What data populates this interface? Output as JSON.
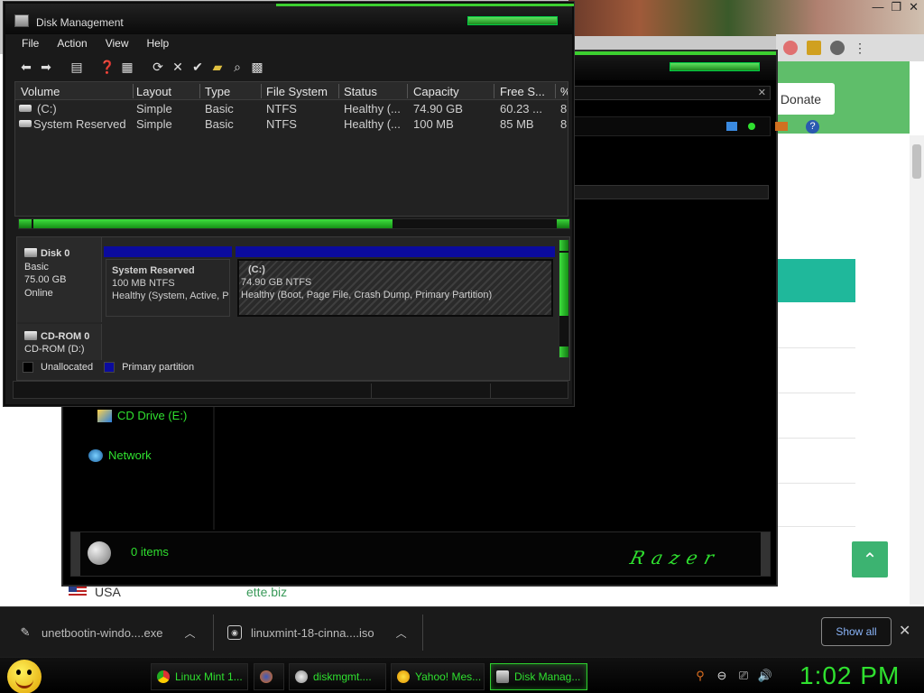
{
  "disk_mgmt": {
    "title": "Disk Management",
    "menu": [
      "File",
      "Action",
      "View",
      "Help"
    ],
    "columns": [
      "Volume",
      "Layout",
      "Type",
      "File System",
      "Status",
      "Capacity",
      "Free S...",
      "%"
    ],
    "volumes": [
      {
        "volume": "(C:)",
        "layout": "Simple",
        "type": "Basic",
        "fs": "NTFS",
        "status": "Healthy (...",
        "capacity": "74.90 GB",
        "free": "60.23 ...",
        "pct": "8"
      },
      {
        "volume": "System Reserved",
        "layout": "Simple",
        "type": "Basic",
        "fs": "NTFS",
        "status": "Healthy (...",
        "capacity": "100 MB",
        "free": "85 MB",
        "pct": "8"
      }
    ],
    "disks": [
      {
        "name": "Disk 0",
        "kind": "Basic",
        "size": "75.00 GB",
        "state": "Online"
      },
      {
        "name": "CD-ROM 0",
        "kind": "CD-ROM (D:)"
      }
    ],
    "partitions": [
      {
        "name": "System Reserved",
        "size": "100 MB NTFS",
        "status": "Healthy (System, Active, P"
      },
      {
        "name": "(C:)",
        "size": "74.90 GB NTFS",
        "status": "Healthy (Boot, Page File, Crash Dump, Primary Partition)"
      }
    ],
    "legend": {
      "unallocated": "Unallocated",
      "primary": "Primary partition"
    },
    "colors": {
      "primary": "#0b0b9e",
      "unallocated": "#000000"
    }
  },
  "explorer": {
    "nav": {
      "cd_drive": "CD Drive (E:)",
      "network": "Network"
    },
    "status": "0 items",
    "brand": "Razer"
  },
  "browser": {
    "donate": "Donate",
    "country": "USA",
    "site": "ette.biz"
  },
  "downloads": {
    "items": [
      "unetbootin-windo....exe",
      "linuxmint-18-cinna....iso"
    ],
    "show_all": "Show all"
  },
  "taskbar": {
    "items": [
      "Linux Mint 1...",
      "diskmgmt....",
      "Yahoo! Mes...",
      "Disk Manag..."
    ],
    "clock": "1:02 PM"
  }
}
